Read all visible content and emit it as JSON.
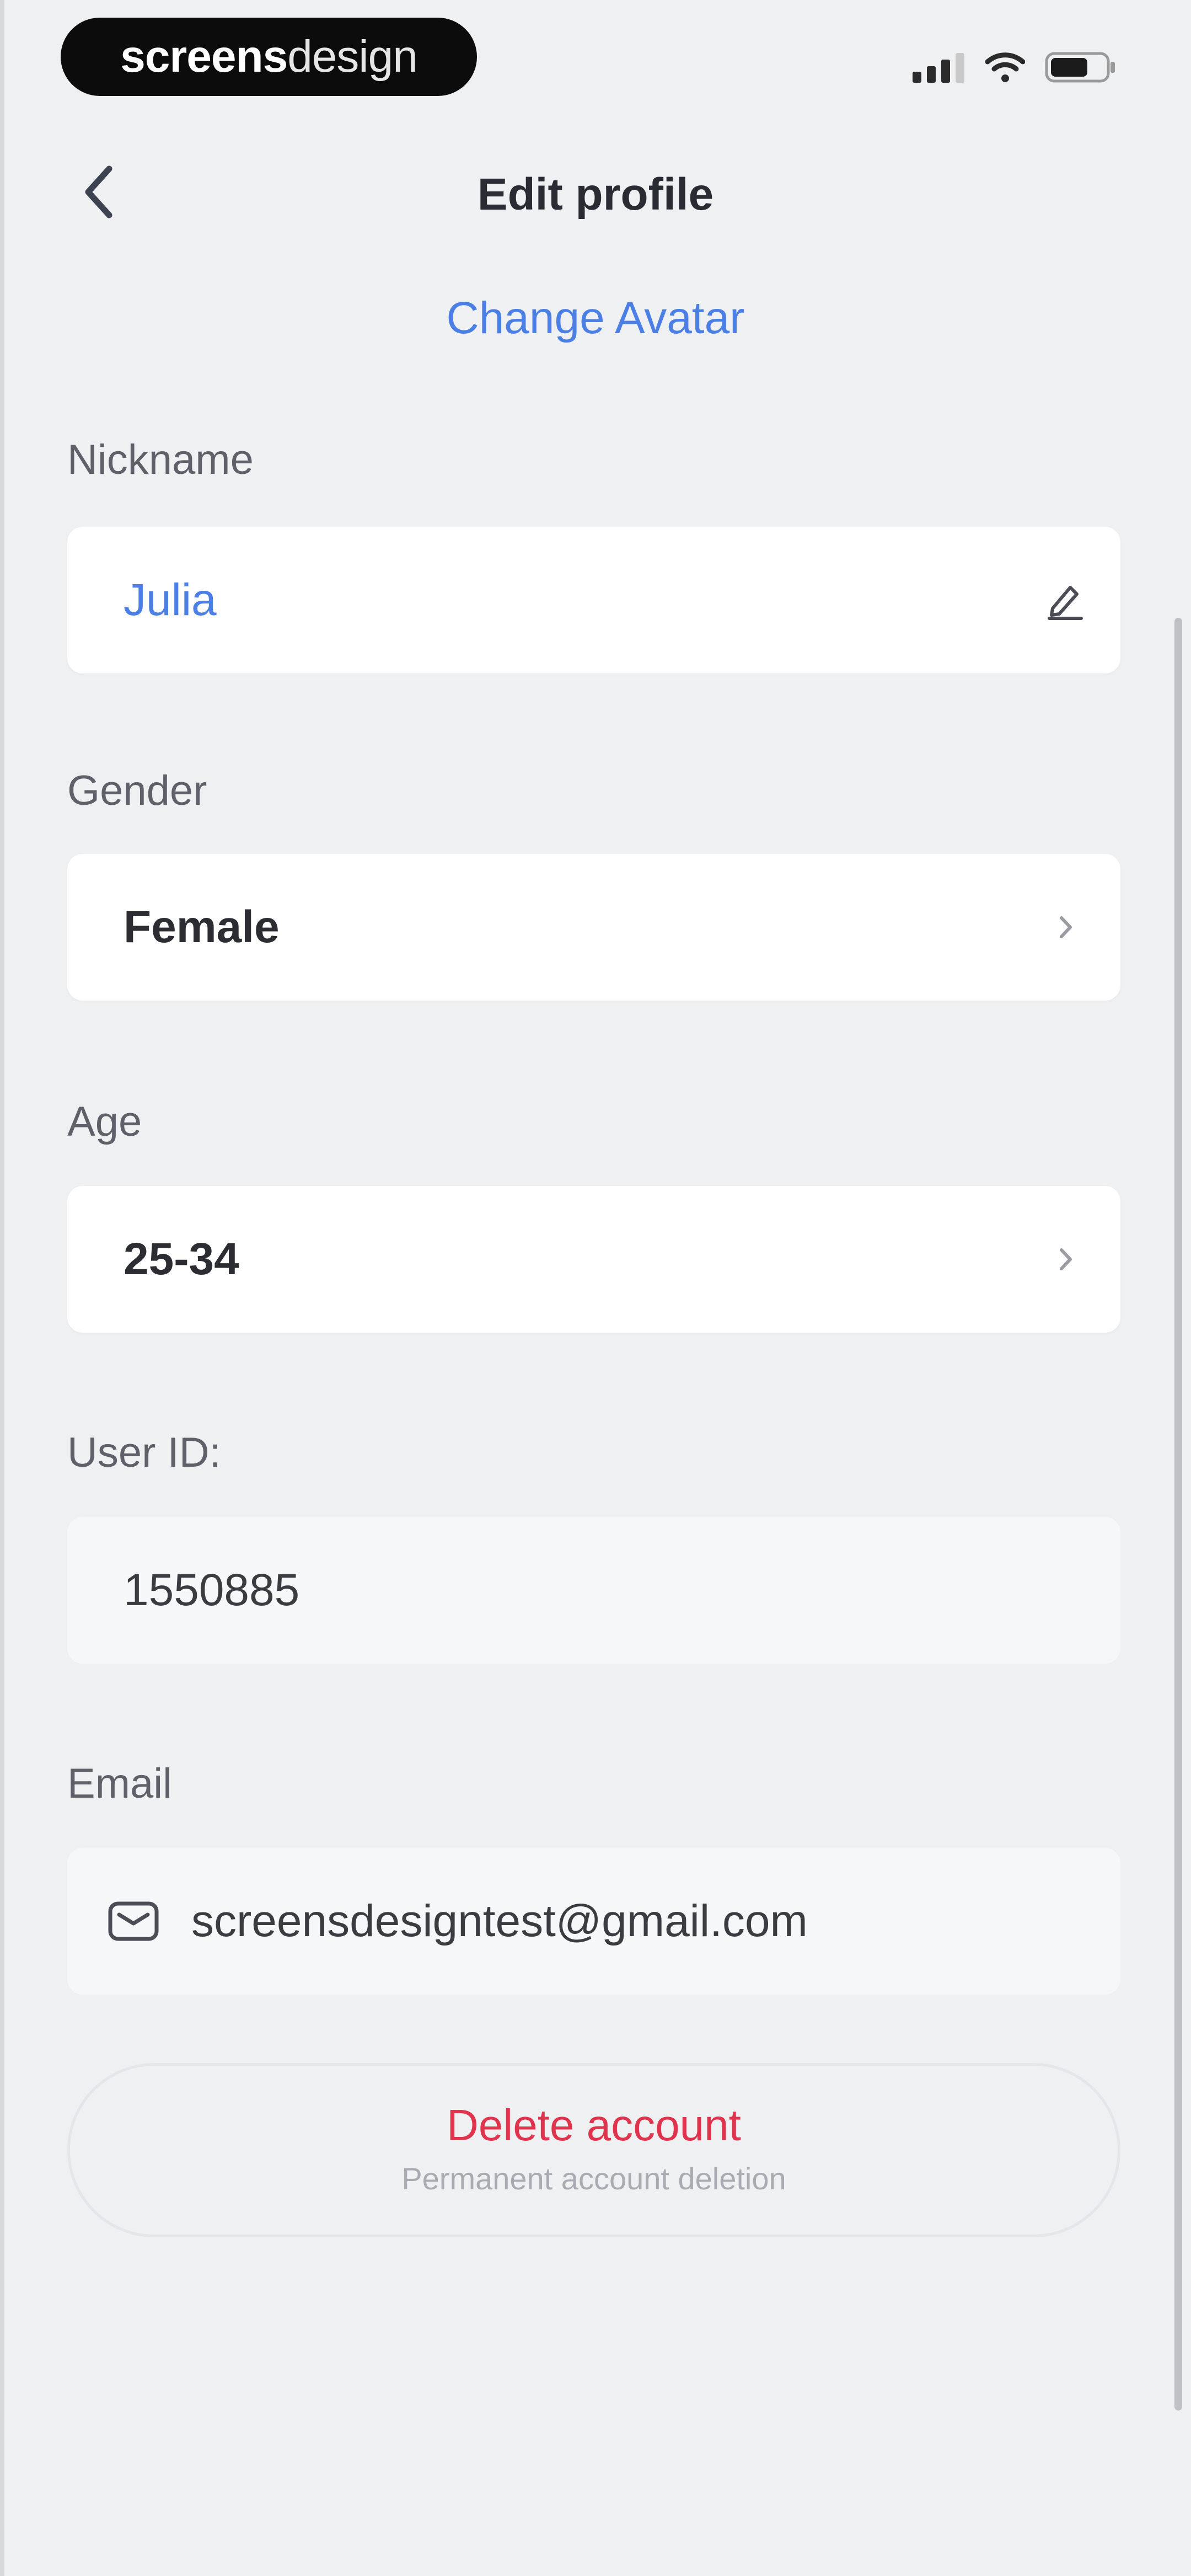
{
  "status_bar": {
    "brand_bold": "screens",
    "brand_light": "design",
    "icons": [
      "signal-icon",
      "wifi-icon",
      "battery-icon"
    ]
  },
  "nav": {
    "title": "Edit profile",
    "back_icon": "chevron-left-icon"
  },
  "change_avatar": "Change Avatar",
  "fields": {
    "nickname": {
      "label": "Nickname",
      "value": "Julia",
      "icon": "edit-pencil-icon"
    },
    "gender": {
      "label": "Gender",
      "value": "Female",
      "icon": "chevron-right-icon"
    },
    "age": {
      "label": "Age",
      "value": "25-34",
      "icon": "chevron-right-icon"
    },
    "user_id": {
      "label": "User ID:",
      "value": "1550885"
    },
    "email": {
      "label": "Email",
      "value": "screensdesigntest@gmail.com",
      "icon": "mail-icon"
    }
  },
  "delete_account": {
    "title": "Delete account",
    "subtitle": "Permanent account deletion"
  },
  "colors": {
    "accent": "#4b7fe6",
    "danger": "#e0334e",
    "background": "#eff0f2"
  }
}
